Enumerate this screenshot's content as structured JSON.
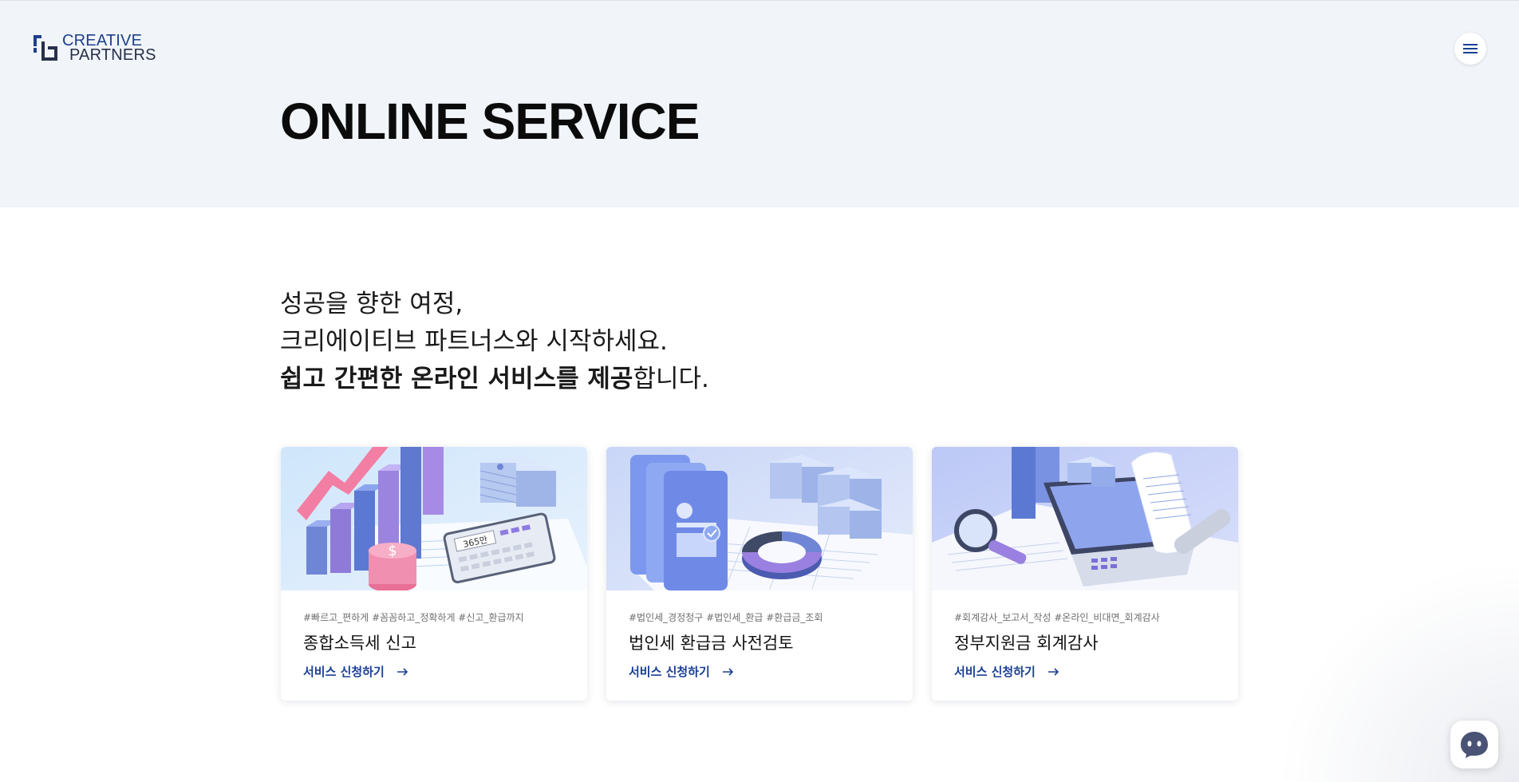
{
  "brand": {
    "line1": "CREATIVE",
    "line2": "PARTNERS",
    "accent": "#1d3f8e"
  },
  "header": {
    "menu_icon": "hamburger-menu-icon"
  },
  "hero": {
    "title": "ONLINE SERVICE",
    "background": "#f1f4f8"
  },
  "intro": {
    "line1": "성공을 향한 여정,",
    "line2": "크리에이티브 파트너스와 시작하세요.",
    "line3_bold": "쉽고 간편한 온라인 서비스를 제공",
    "line3_rest": "합니다."
  },
  "cards": [
    {
      "tags": "#빠르고_편하게 #꼼꼼하고_정확하게 #신고_환급까지",
      "title": "종합소득세 신고",
      "link": "서비스 신청하기",
      "calculator_text": "365만",
      "illustration": "tax-chart-calculator-illustration"
    },
    {
      "tags": "#법인세_경정청구 #법인세_환급 #환급금_조회",
      "title": "법인세 환급금 사전검토",
      "link": "서비스 신청하기",
      "illustration": "refund-documents-illustration"
    },
    {
      "tags": "#회계감사_보고서_작성 #온라인_비대면_회계감사",
      "title": "정부지원금 회계감사",
      "link": "서비스 신청하기",
      "illustration": "audit-laptop-illustration"
    }
  ],
  "link_color": "#1b3f93",
  "chat": {
    "icon": "chat-bot-icon"
  }
}
